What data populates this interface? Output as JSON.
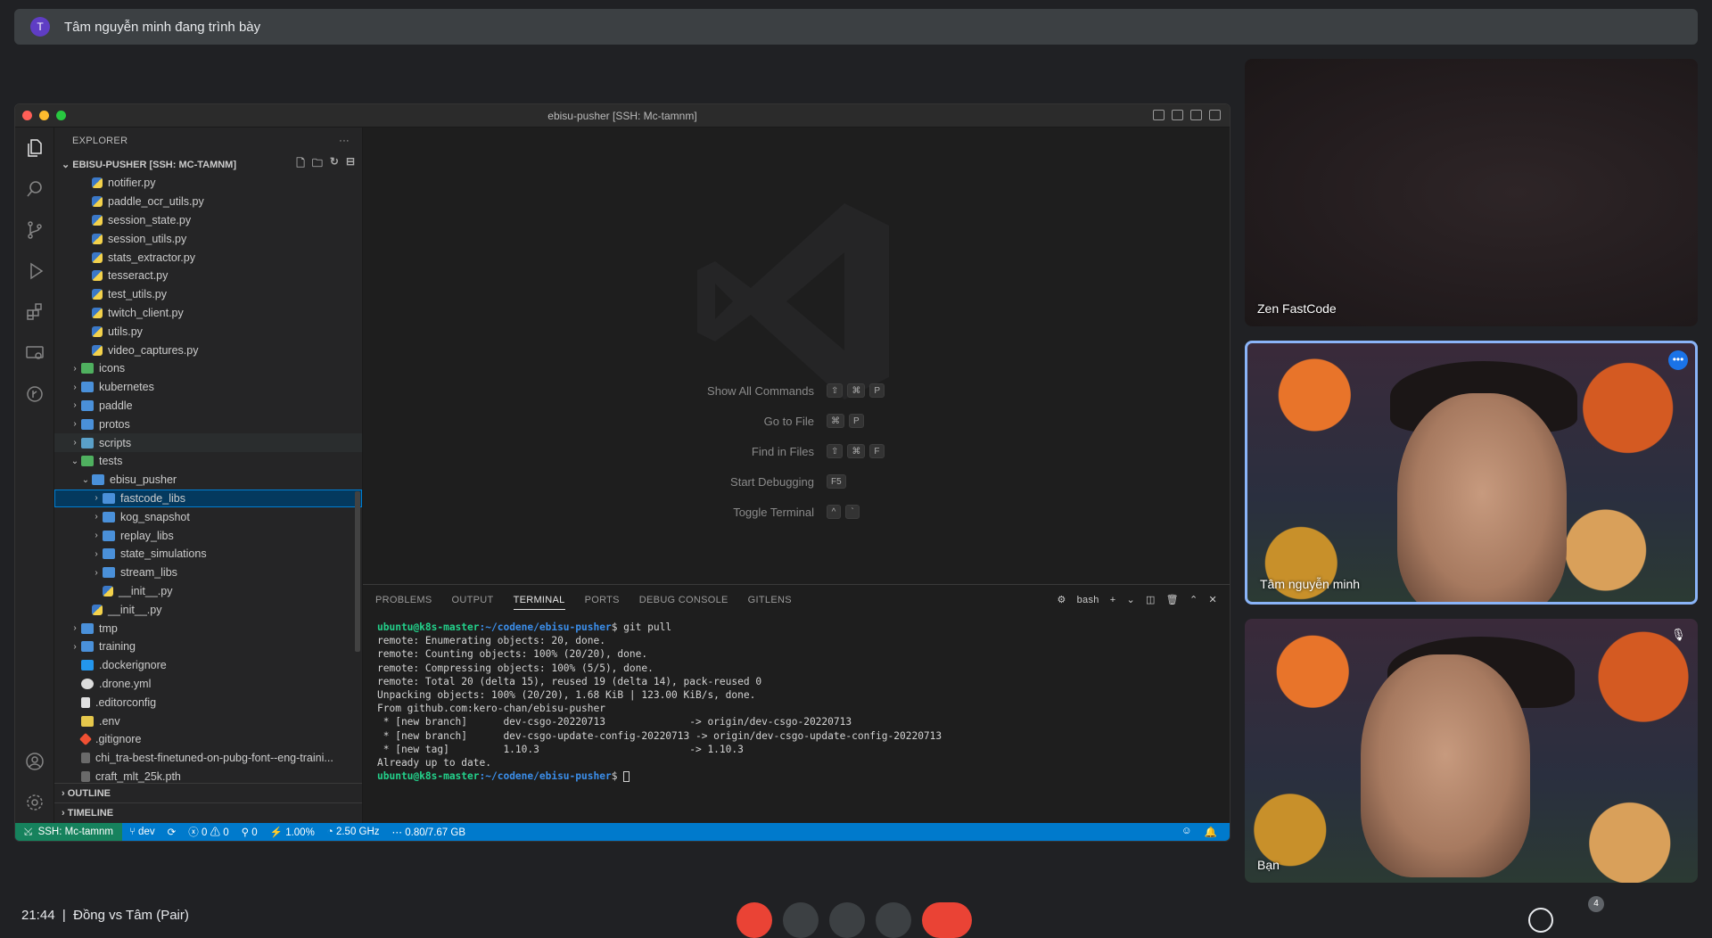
{
  "presenting": {
    "avatar_letter": "T",
    "text": "Tâm nguyễn minh đang trình bày"
  },
  "vscode": {
    "window_title": "ebisu-pusher [SSH: Mc-tamnm]",
    "sidebar": {
      "title": "EXPLORER",
      "more": "···",
      "section": "EBISU-PUSHER [SSH: MC-TAMNM]",
      "tree": [
        {
          "label": "notifier.py",
          "indent": 2,
          "icon": "py",
          "chev": ""
        },
        {
          "label": "paddle_ocr_utils.py",
          "indent": 2,
          "icon": "py",
          "chev": ""
        },
        {
          "label": "session_state.py",
          "indent": 2,
          "icon": "py",
          "chev": ""
        },
        {
          "label": "session_utils.py",
          "indent": 2,
          "icon": "py",
          "chev": ""
        },
        {
          "label": "stats_extractor.py",
          "indent": 2,
          "icon": "py",
          "chev": ""
        },
        {
          "label": "tesseract.py",
          "indent": 2,
          "icon": "py",
          "chev": ""
        },
        {
          "label": "test_utils.py",
          "indent": 2,
          "icon": "py",
          "chev": ""
        },
        {
          "label": "twitch_client.py",
          "indent": 2,
          "icon": "py",
          "chev": ""
        },
        {
          "label": "utils.py",
          "indent": 2,
          "icon": "py",
          "chev": ""
        },
        {
          "label": "video_captures.py",
          "indent": 2,
          "icon": "py",
          "chev": ""
        },
        {
          "label": "icons",
          "indent": 1,
          "icon": "folder-green",
          "chev": "›"
        },
        {
          "label": "kubernetes",
          "indent": 1,
          "icon": "folder",
          "chev": "›"
        },
        {
          "label": "paddle",
          "indent": 1,
          "icon": "folder",
          "chev": "›"
        },
        {
          "label": "protos",
          "indent": 1,
          "icon": "folder",
          "chev": "›"
        },
        {
          "label": "scripts",
          "indent": 1,
          "icon": "folder-special",
          "chev": "›",
          "state": "hover"
        },
        {
          "label": "tests",
          "indent": 1,
          "icon": "folder-green",
          "chev": "⌄"
        },
        {
          "label": "ebisu_pusher",
          "indent": 2,
          "icon": "folder",
          "chev": "⌄"
        },
        {
          "label": "fastcode_libs",
          "indent": 3,
          "icon": "folder",
          "chev": "›",
          "state": "selected"
        },
        {
          "label": "kog_snapshot",
          "indent": 3,
          "icon": "folder",
          "chev": "›"
        },
        {
          "label": "replay_libs",
          "indent": 3,
          "icon": "folder",
          "chev": "›"
        },
        {
          "label": "state_simulations",
          "indent": 3,
          "icon": "folder",
          "chev": "›"
        },
        {
          "label": "stream_libs",
          "indent": 3,
          "icon": "folder",
          "chev": "›"
        },
        {
          "label": "__init__.py",
          "indent": 3,
          "icon": "py",
          "chev": ""
        },
        {
          "label": "__init__.py",
          "indent": 2,
          "icon": "py",
          "chev": ""
        },
        {
          "label": "tmp",
          "indent": 1,
          "icon": "folder",
          "chev": "›"
        },
        {
          "label": "training",
          "indent": 1,
          "icon": "folder",
          "chev": "›"
        },
        {
          "label": ".dockerignore",
          "indent": 1,
          "icon": "docker",
          "chev": ""
        },
        {
          "label": ".drone.yml",
          "indent": 1,
          "icon": "drone",
          "chev": ""
        },
        {
          "label": ".editorconfig",
          "indent": 1,
          "icon": "editor",
          "chev": ""
        },
        {
          "label": ".env",
          "indent": 1,
          "icon": "env",
          "chev": ""
        },
        {
          "label": ".gitignore",
          "indent": 1,
          "icon": "git",
          "chev": ""
        },
        {
          "label": "chi_tra-best-finetuned-on-pubg-font--eng-traini...",
          "indent": 1,
          "icon": "file",
          "chev": ""
        },
        {
          "label": "craft_mlt_25k.pth",
          "indent": 1,
          "icon": "file",
          "chev": ""
        }
      ],
      "outline": "OUTLINE",
      "timeline": "TIMELINE"
    },
    "shortcuts": [
      {
        "label": "Show All Commands",
        "keys": [
          "⇧",
          "⌘",
          "P"
        ]
      },
      {
        "label": "Go to File",
        "keys": [
          "⌘",
          "P"
        ]
      },
      {
        "label": "Find in Files",
        "keys": [
          "⇧",
          "⌘",
          "F"
        ]
      },
      {
        "label": "Start Debugging",
        "keys": [
          "F5"
        ]
      },
      {
        "label": "Toggle Terminal",
        "keys": [
          "^",
          "`"
        ]
      }
    ],
    "panel": {
      "tabs": [
        "PROBLEMS",
        "OUTPUT",
        "TERMINAL",
        "PORTS",
        "DEBUG CONSOLE",
        "GITLENS"
      ],
      "active_tab": "TERMINAL",
      "shell": "bash",
      "prompt_user": "ubuntu@k8s-master",
      "prompt_path": ":~/codene/ebisu-pusher",
      "command": "$ git pull",
      "output": [
        "remote: Enumerating objects: 20, done.",
        "remote: Counting objects: 100% (20/20), done.",
        "remote: Compressing objects: 100% (5/5), done.",
        "remote: Total 20 (delta 15), reused 19 (delta 14), pack-reused 0",
        "Unpacking objects: 100% (20/20), 1.68 KiB | 123.00 KiB/s, done.",
        "From github.com:kero-chan/ebisu-pusher",
        " * [new branch]      dev-csgo-20220713              -> origin/dev-csgo-20220713",
        " * [new branch]      dev-csgo-update-config-20220713 -> origin/dev-csgo-update-config-20220713",
        " * [new tag]         1.10.3                         -> 1.10.3",
        "Already up to date."
      ],
      "final_prompt": "$ "
    },
    "status": {
      "remote": "SSH: Mc-tamnm",
      "branch": "dev",
      "errors": "0",
      "warnings": "0",
      "ports": "0",
      "cpu": "1.00%",
      "freq": "2.50 GHz",
      "mem": "0.80/7.67 GB"
    }
  },
  "participants": [
    {
      "name": "Zen FastCode"
    },
    {
      "name": "Tâm nguyễn minh"
    },
    {
      "name": "Bạn"
    }
  ],
  "meeting": {
    "time": "21:44",
    "title": "Đồng vs Tâm (Pair)",
    "people_count": "4"
  }
}
